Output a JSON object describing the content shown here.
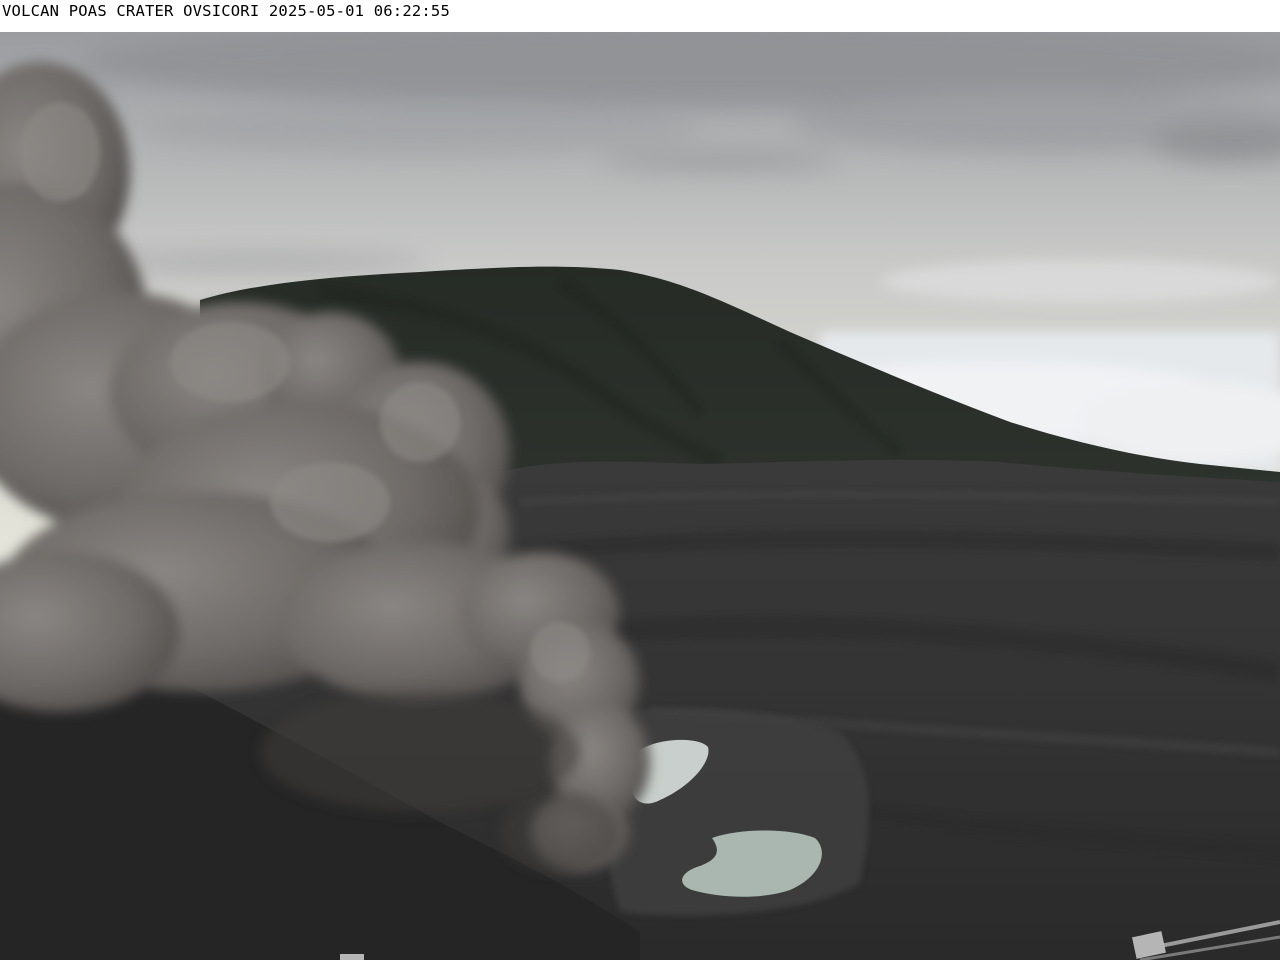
{
  "camera": {
    "caption": "VOLCAN POAS CRATER OVSICORI 2025-05-01 06:22:55"
  },
  "scene": {
    "subject": "volcanic-ash-plume-over-crater",
    "colors": {
      "sky_light": "#e6e6de",
      "sky_cloud": "#8d8f92",
      "mountain": "#2a2f2a",
      "crater_floor": "#3b3b3b",
      "ash_plume": "#6f6b68",
      "lake": "#a9b7b0",
      "cloud_sea": "#e9ecef"
    }
  }
}
